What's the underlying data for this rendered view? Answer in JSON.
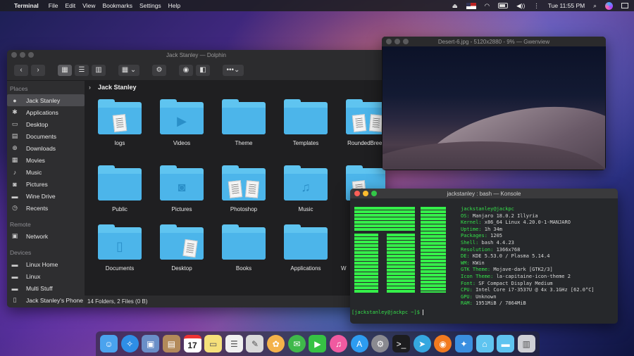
{
  "menubar": {
    "app_name": "Terminal",
    "items": [
      "File",
      "Edit",
      "View",
      "Bookmarks",
      "Settings",
      "Help"
    ],
    "clock": "Tue 11:55 PM"
  },
  "dolphin": {
    "title": "Jack Stanley — Dolphin",
    "breadcrumb": "Jack Stanley",
    "places_header": "Places",
    "places": [
      "Jack Stanley",
      "Applications",
      "Desktop",
      "Documents",
      "Downloads",
      "Movies",
      "Music",
      "Pictures",
      "Wine Drive",
      "Recents"
    ],
    "remote_header": "Remote",
    "remote": [
      "Network"
    ],
    "devices_header": "Devices",
    "devices": [
      "Linux Home",
      "Linux",
      "Multi Stuff",
      "Jack Stanley's Phone"
    ],
    "folders": [
      "logs",
      "Videos",
      "Theme",
      "Templates",
      "RoundedBreeze",
      "Public",
      "Pictures",
      "Photoshop",
      "Music",
      "",
      "Documents",
      "Desktop",
      "Books",
      "Applications",
      "W"
    ],
    "status": "14 Folders, 2 Files (0 B)"
  },
  "gwenview": {
    "title": "Desert-6.jpg - 5120x2880 - 9% — Gwenview"
  },
  "konsole": {
    "title": "jackstanley : bash — Konsole",
    "userhost": "jackstanley@jackpc",
    "info": [
      {
        "k": "OS:",
        "v": " Manjaro 18.0.2 Illyria"
      },
      {
        "k": "Kernel:",
        "v": " x86_64 Linux 4.20.0-1-MANJARO"
      },
      {
        "k": "Uptime:",
        "v": " 1h 34m"
      },
      {
        "k": "Packages:",
        "v": " 1205"
      },
      {
        "k": "Shell:",
        "v": " bash 4.4.23"
      },
      {
        "k": "Resolution:",
        "v": " 1366x768"
      },
      {
        "k": "DE:",
        "v": " KDE 5.53.0 / Plasma 5.14.4"
      },
      {
        "k": "WM:",
        "v": " KWin"
      },
      {
        "k": "GTK Theme:",
        "v": " Mojave-dark [GTK2/3]"
      },
      {
        "k": "Icon Theme:",
        "v": " la-capitaine-icon-theme 2"
      },
      {
        "k": "Font:",
        "v": " SF Compact Display Medium"
      },
      {
        "k": "CPU:",
        "v": " Intel Core i7-3537U @ 4x 3.1GHz [62.0°C]"
      },
      {
        "k": "GPU:",
        "v": " Unknown"
      },
      {
        "k": "RAM:",
        "v": " 1951MiB / 7864MiB"
      }
    ],
    "prompt": "[jackstanley@jackpc ~]$"
  },
  "dock": {
    "calendar_day": "17",
    "icons": [
      {
        "name": "finder-icon",
        "color": "#4aa3ee"
      },
      {
        "name": "safari-icon",
        "color": "#2e8ee6"
      },
      {
        "name": "preview-icon",
        "color": "#6a8fc8"
      },
      {
        "name": "contacts-icon",
        "color": "#b38a5a"
      },
      {
        "name": "calendar-icon",
        "color": "#ffffff"
      },
      {
        "name": "notes-icon",
        "color": "#f5e07a"
      },
      {
        "name": "reminders-icon",
        "color": "#f0f0f0"
      },
      {
        "name": "photo-editor-icon",
        "color": "#d9d9d9"
      },
      {
        "name": "photos-icon",
        "color": "#f4b24a"
      },
      {
        "name": "messages-icon",
        "color": "#3fb84a"
      },
      {
        "name": "facetime-icon",
        "color": "#36c244"
      },
      {
        "name": "itunes-icon",
        "color": "#f05aa0"
      },
      {
        "name": "app-store-icon",
        "color": "#2d9cf0"
      },
      {
        "name": "system-preferences-icon",
        "color": "#8a8a90"
      },
      {
        "name": "terminal-icon",
        "color": "#1d1d1f"
      },
      {
        "name": "telegram-icon",
        "color": "#35a7e0"
      },
      {
        "name": "firefox-icon",
        "color": "#f27a1f"
      },
      {
        "name": "kde-connect-icon",
        "color": "#3a8fe0"
      },
      {
        "name": "home-folder-icon",
        "color": "#5fc4f0"
      },
      {
        "name": "folder-icon",
        "color": "#5fc4f0"
      },
      {
        "name": "trash-icon",
        "color": "#cfd0d4"
      }
    ]
  }
}
